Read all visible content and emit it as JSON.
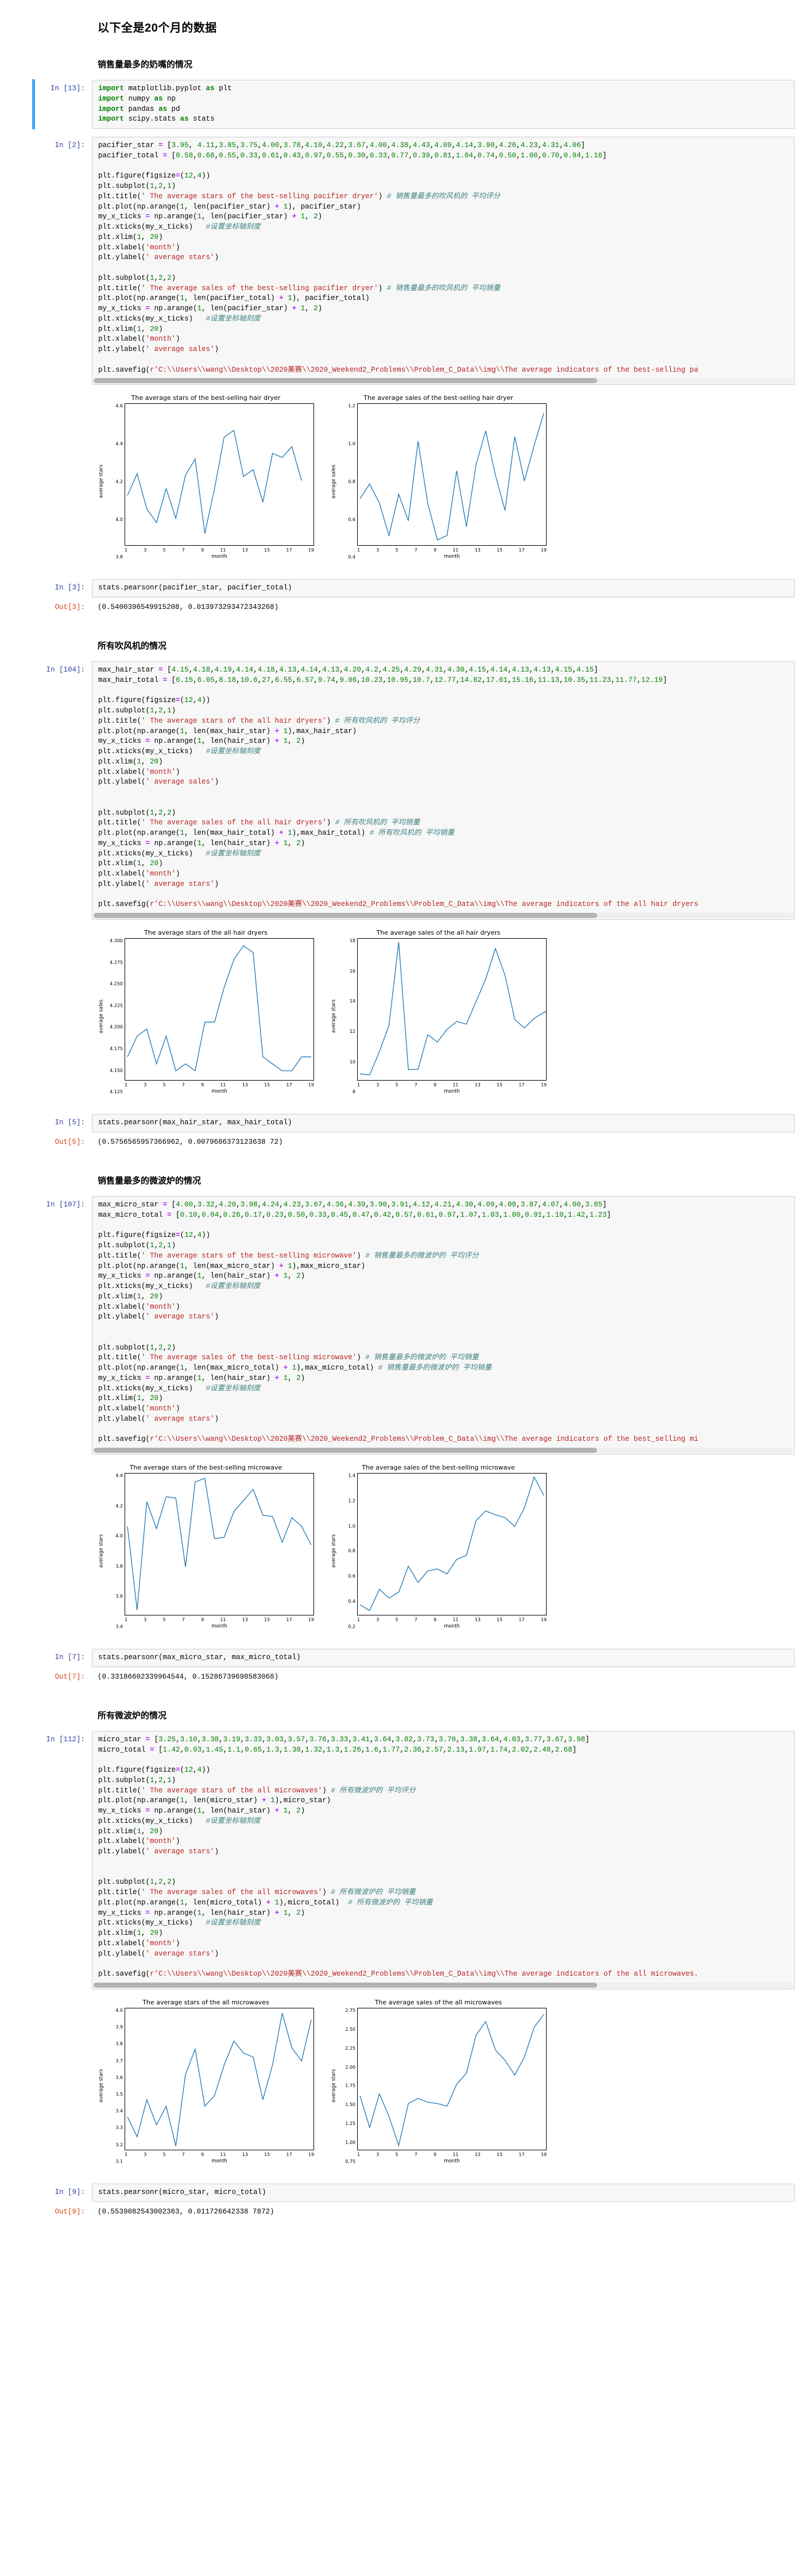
{
  "headings": {
    "main": "以下全是20个月的数据",
    "sec1": "销售量最多的奶嘴的情况",
    "sec2": "所有吹风机的情况",
    "sec3": "销售量最多的微波炉的情况",
    "sec4": "所有微波炉的情况"
  },
  "prompts": {
    "in13": "In [13]:",
    "in2": "In [2]:",
    "in3": "In [3]:",
    "out3": "Out[3]:",
    "in104": "In [104]:",
    "in5": "In [5]:",
    "out5": "Out[5]:",
    "in107": "In [107]:",
    "in7": "In [7]:",
    "out7": "Out[7]:",
    "in112": "In [112]:",
    "in9": "In [9]:",
    "out9": "Out[9]:"
  },
  "cells": {
    "imports": [
      "import matplotlib.pyplot as plt",
      "import numpy as np",
      "import pandas as pd",
      "import scipy.stats as stats"
    ],
    "pacifier_code": [
      "pacifier_star = [3.95, 4.11,3.85,3.75,4.00,3.78,4.10,4.22,3.67,4.00,4.38,4.43,4.09,4.14,3.90,4.26,4.23,4.31,4.06]",
      "pacifier_total = [0.58,0.68,0.55,0.33,0.61,0.43,0.97,0.55,0.30,0.33,0.77,0.39,0.81,1.04,0.74,0.50,1.00,0.70,0.94,1.16]",
      "",
      "plt.figure(figsize=(12,4))",
      "plt.subplot(1,2,1)",
      "plt.title('The average stars of the best-selling pacifier dryer')  # 销售量最多的吹风机的 平均评分",
      "plt.plot(np.arange(1, len(pacifier_star) + 1), pacifier_star)",
      "my_x_ticks = np.arange(1, len(pacifier_star) + 1, 2)",
      "plt.xticks(my_x_ticks)    #设置坐标轴刻度",
      "plt.xlim(1, 20)",
      "plt.xlabel('month')",
      "plt.ylabel('average stars')",
      "",
      "plt.subplot(1,2,2)",
      "plt.title('The average sales of the best-selling pacifier dryer')  # 销售量最多的吹风机的 平均销量",
      "plt.plot(np.arange(1, len(pacifier_total) + 1), pacifier_total)",
      "my_x_ticks = np.arange(1, len(pacifier_star) + 1, 2)",
      "plt.xticks(my_x_ticks)    #设置坐标轴刻度",
      "plt.xlim(1, 20)",
      "plt.xlabel('month')",
      "plt.ylabel('average sales')",
      "",
      "plt.savefig(r'C:\\\\Users\\\\wang\\\\Desktop\\\\2020美赛\\\\2020_Weekend2_Problems\\\\Problem_C_Data\\\\img\\\\The average indicators of the best-selling pa"
    ],
    "pearson_pacifier_code": "stats.pearsonr(pacifier_star, pacifier_total)",
    "pearson_pacifier_out": "(0.5400396549915208, 0.013973293472343268)",
    "hair_code": [
      "max_hair_star = [4.15,4.18,4.19,4.14,4.18,4.13,4.14,4.13,4.20,4.2,4.25,4.29,4.31,4.30,4.15,4.14,4.13,4.13,4.15,4.15]",
      "max_hair_total = [6.15,6.05,8.18,10.6,27,6.55,6.57,9.74,9.06,10.23,10.95,10.7,12.77,14.82,17.61,15.16,11.13,10.35,11.23,11.77,12.19]",
      "",
      "plt.figure(figsize=(12,4))",
      "plt.subplot(1,2,1)",
      "plt.title('The average stars of the all hair dryers')  # 所有吹风机的 平均评分",
      "plt.plot(np.arange(1, len(max_hair_star) + 1), max_hair_star)",
      "my_x_ticks = np.arange(1, len(hair_star) + 1, 2)",
      "plt.xticks(my_x_ticks)    #设置坐标轴刻度",
      "plt.xlim(1, 20)",
      "plt.xlabel('month')",
      "plt.ylabel('average sales')",
      "",
      "",
      "plt.subplot(1,2,2)",
      "plt.title('The average sales of the all hair dryers')  # 所有吹风机的 平均销量",
      "plt.plot(np.arange(1, len(max_hair_total) + 1), max_hair_total)",
      "my_x_ticks = np.arange(1, len(hair_star) + 1, 2)",
      "plt.xticks(my_x_ticks)    #设置坐标轴刻度",
      "plt.xlim(1, 20)",
      "plt.xlabel('month')",
      "plt.ylabel('average stars')",
      "",
      "plt.savefig(r'C:\\\\Users\\\\wang\\\\Desktop\\\\2020美赛\\\\2020_Weekend2_Problems\\\\Problem_C_Data\\\\img\\\\The average indicators of the all hair dryers"
    ],
    "pearson_hair_code": "stats.pearsonr(max_hair_star, max_hair_total)",
    "pearson_hair_out": "(0.5756565957366962, 0.0079686373123638 72)",
    "micro_code": [
      "max_micro_star = [4.00,3.32,4.20,3.98,4.24,4.23,3.67,4.36,4.39,3.90,3.91,4.12,4.21,4.30,4.09,4.08,3.87,4.07,4.00,3.85]",
      "max_micro_total = [0.10,0.04,0.26,0.17,0.23,0.50,0.33,0.45,0.47,0.42,0.57,0.61,0.97,1.07,1.03,1.00,0.91,1.10,1.42,1.23]",
      "",
      "plt.figure(figsize=(12,4))",
      "plt.subplot(1,2,1)",
      "plt.title('The average stars of the best-selling microwave')  # 销售量最多的微波炉的 平均评分",
      "plt.plot(np.arange(1, len(max_micro_star) + 1), max_micro_star)",
      "my_x_ticks = np.arange(1, len(hair_star) + 1, 2)",
      "plt.xticks(my_x_ticks)    #设置坐标轴刻度",
      "plt.xlim(1, 20)",
      "plt.xlabel('month')",
      "plt.ylabel('average stars')",
      "",
      "",
      "plt.subplot(1,2,2)",
      "plt.title('The average sales of the best-selling microwave')  # 销售量最多的微波炉的 平均销量",
      "plt.plot(np.arange(1, len(max_micro_total) + 1),max_micro_total)  # 销售量最多的微波炉的 平均销量",
      "my_x_ticks = np.arange(1, len(hair_star) + 1, 2)",
      "plt.xticks(my_x_ticks)    #设置坐标轴刻度",
      "plt.xlim(1, 20)",
      "plt.xlabel('month')",
      "plt.ylabel('average stars')",
      "",
      "plt.savefig(r'C:\\\\Users\\\\wang\\\\Desktop\\\\2020美赛\\\\2020_Weekend2_Problems\\\\Problem_C_Data\\\\img\\\\The average indicators of the best_selling mi"
    ],
    "pearson_micro_code": "stats.pearsonr(max_micro_star, max_micro_total)",
    "pearson_micro_out": "(0.33186602339964544, 0.15286739698583068)",
    "allmicro_code": [
      "micro_star = [3.25,3.10,3.38,3.19,3.33,3.03,3.57,3.76,3.33,3.41,3.64,3.82,3.73,3.70,3.38,3.64,4.03,3.77,3.67,3.98]",
      "micro_total = [1.42,0.93,1.45,1.1,0.65,1.3,1.38,1.32,1.3,1.26,1.6,1.77,2.36,2.57,2.13,1.97,1.74,2.02,2.48,2.68]",
      "",
      "plt.figure(figsize=(12,4))",
      "plt.subplot(1,2,1)",
      "plt.title('The average stars of the all microwaves')  # 所有微波炉的 平均评分",
      "plt.plot(np.arange(1, len(micro_star) + 1),micro_star)",
      "my_x_ticks = np.arange(1, len(hair_star) + 1, 2)",
      "plt.xticks(my_x_ticks)    #设置坐标轴刻度",
      "plt.xlim(1, 20)",
      "plt.xlabel('month')",
      "plt.ylabel('average stars')",
      "",
      "",
      "plt.subplot(1,2,2)",
      "plt.title('The average sales of the all microwaves')  # 所有微波炉的 平均销量",
      "plt.plot(np.arange(1, len(micro_total) + 1),micro_total)   # 所有微波炉的 平均销量",
      "my_x_ticks = np.arange(1, len(hair_star) + 1, 2)",
      "plt.xticks(my_x_ticks)    #设置坐标轴刻度",
      "plt.xlim(1, 20)",
      "plt.xlabel('month')",
      "plt.ylabel('average stars')",
      "",
      "plt.savefig(r'C:\\\\Users\\\\wang\\\\Desktop\\\\2020美赛\\\\2020_Weekend2_Problems\\\\Problem_C_Data\\\\img\\\\The average indicators of the all microwaves."
    ],
    "pearson_allmicro_code": "stats.pearsonr(micro_star, micro_total)",
    "pearson_allmicro_out": "(0.5539082543002363, 0.011726642338 7872)"
  },
  "chart_data": [
    {
      "type": "line",
      "title": "The average stars of the best-selling hair dryer",
      "xlabel": "month",
      "ylabel": "average stars",
      "x": [
        1,
        2,
        3,
        4,
        5,
        6,
        7,
        8,
        9,
        10,
        11,
        12,
        13,
        14,
        15,
        16,
        17,
        18,
        19
      ],
      "values": [
        3.95,
        4.11,
        3.85,
        3.75,
        4.0,
        3.78,
        4.1,
        4.22,
        3.67,
        4.0,
        4.38,
        4.43,
        4.09,
        4.14,
        3.9,
        4.26,
        4.23,
        4.31,
        4.06
      ],
      "xticks": [
        1,
        3,
        5,
        7,
        9,
        11,
        13,
        15,
        17,
        19
      ],
      "yticks": [
        "3.8",
        "4.0",
        "4.2",
        "4.4",
        "4.6"
      ],
      "xlim": [
        1,
        20
      ],
      "ylim": [
        3.6,
        4.6
      ],
      "grid": false,
      "color": "#1f77b4"
    },
    {
      "type": "line",
      "title": "The average sales of the best-selling hair dryer",
      "xlabel": "month",
      "ylabel": "average sales",
      "x": [
        1,
        2,
        3,
        4,
        5,
        6,
        7,
        8,
        9,
        10,
        11,
        12,
        13,
        14,
        15,
        16,
        17,
        18,
        19,
        20
      ],
      "values": [
        0.58,
        0.68,
        0.55,
        0.33,
        0.61,
        0.43,
        0.97,
        0.55,
        0.3,
        0.33,
        0.77,
        0.39,
        0.81,
        1.04,
        0.74,
        0.5,
        1.0,
        0.7,
        0.94,
        1.16
      ],
      "xticks": [
        1,
        3,
        5,
        7,
        9,
        11,
        13,
        15,
        17,
        19
      ],
      "yticks": [
        "0.4",
        "0.6",
        "0.8",
        "1.0",
        "1.2"
      ],
      "xlim": [
        1,
        20
      ],
      "ylim": [
        0.28,
        1.2
      ],
      "grid": false,
      "color": "#1f77b4"
    },
    {
      "type": "line",
      "title": "The average stars of the all hair dryers",
      "xlabel": "month",
      "ylabel": "average sales",
      "x": [
        1,
        2,
        3,
        4,
        5,
        6,
        7,
        8,
        9,
        10,
        11,
        12,
        13,
        14,
        15,
        16,
        17,
        18,
        19,
        20
      ],
      "values": [
        4.15,
        4.18,
        4.19,
        4.14,
        4.18,
        4.13,
        4.14,
        4.13,
        4.2,
        4.2,
        4.25,
        4.29,
        4.31,
        4.3,
        4.15,
        4.14,
        4.13,
        4.13,
        4.15,
        4.15
      ],
      "xticks": [
        1,
        3,
        5,
        7,
        9,
        11,
        13,
        15,
        17,
        19
      ],
      "yticks": [
        "4.125",
        "4.150",
        "4.175",
        "4.200",
        "4.225",
        "4.250",
        "4.275",
        "4.300"
      ],
      "xlim": [
        1,
        20
      ],
      "ylim": [
        4.12,
        4.315
      ],
      "grid": false,
      "color": "#1f77b4"
    },
    {
      "type": "line",
      "title": "The average sales of the all hair dryers",
      "xlabel": "month",
      "ylabel": "average stars",
      "x": [
        1,
        2,
        3,
        4,
        5,
        6,
        7,
        8,
        9,
        10,
        11,
        12,
        13,
        14,
        15,
        16,
        17,
        18,
        19,
        20,
        21
      ],
      "values": [
        6.15,
        6.05,
        8.18,
        10.6,
        27,
        6.55,
        6.57,
        9.74,
        9.06,
        10.23,
        10.95,
        10.7,
        12.77,
        14.82,
        17.61,
        15.16,
        11.13,
        10.35,
        11.23,
        11.77,
        12.19
      ],
      "xticks": [
        1,
        3,
        5,
        7,
        9,
        11,
        13,
        15,
        17,
        19
      ],
      "yticks": [
        "8",
        "10",
        "12",
        "14",
        "16",
        "18"
      ],
      "xlim": [
        1,
        20
      ],
      "ylim": [
        5.8,
        18.2
      ],
      "grid": false,
      "color": "#1f77b4"
    },
    {
      "type": "line",
      "title": "The average stars of the best-selling microwave",
      "xlabel": "month",
      "ylabel": "average stars",
      "x": [
        1,
        2,
        3,
        4,
        5,
        6,
        7,
        8,
        9,
        10,
        11,
        12,
        13,
        14,
        15,
        16,
        17,
        18,
        19,
        20
      ],
      "values": [
        4.0,
        3.32,
        4.2,
        3.98,
        4.24,
        4.23,
        3.67,
        4.36,
        4.39,
        3.9,
        3.91,
        4.12,
        4.21,
        4.3,
        4.09,
        4.08,
        3.87,
        4.07,
        4.0,
        3.85
      ],
      "xticks": [
        1,
        3,
        5,
        7,
        9,
        11,
        13,
        15,
        17,
        19
      ],
      "yticks": [
        "3.4",
        "3.6",
        "3.8",
        "4.0",
        "4.2",
        "4.4"
      ],
      "xlim": [
        1,
        20
      ],
      "ylim": [
        3.3,
        4.4
      ],
      "grid": false,
      "color": "#1f77b4"
    },
    {
      "type": "line",
      "title": "The average sales of the best-selling microwave",
      "xlabel": "month",
      "ylabel": "average stars",
      "x": [
        1,
        2,
        3,
        4,
        5,
        6,
        7,
        8,
        9,
        10,
        11,
        12,
        13,
        14,
        15,
        16,
        17,
        18,
        19,
        20
      ],
      "values": [
        0.1,
        0.04,
        0.26,
        0.17,
        0.23,
        0.5,
        0.33,
        0.45,
        0.47,
        0.42,
        0.57,
        0.61,
        0.97,
        1.07,
        1.03,
        1.0,
        0.91,
        1.1,
        1.42,
        1.23
      ],
      "xticks": [
        1,
        3,
        5,
        7,
        9,
        11,
        13,
        15,
        17,
        19
      ],
      "yticks": [
        "0.2",
        "0.4",
        "0.6",
        "0.8",
        "1.0",
        "1.2",
        "1.4"
      ],
      "xlim": [
        1,
        20
      ],
      "ylim": [
        0.02,
        1.42
      ],
      "grid": false,
      "color": "#1f77b4"
    },
    {
      "type": "line",
      "title": "The average stars of the all microwaves",
      "xlabel": "month",
      "ylabel": "average stars",
      "x": [
        1,
        2,
        3,
        4,
        5,
        6,
        7,
        8,
        9,
        10,
        11,
        12,
        13,
        14,
        15,
        16,
        17,
        18,
        19,
        20
      ],
      "values": [
        3.25,
        3.1,
        3.38,
        3.19,
        3.33,
        3.03,
        3.57,
        3.76,
        3.33,
        3.41,
        3.64,
        3.82,
        3.73,
        3.7,
        3.38,
        3.64,
        4.03,
        3.77,
        3.67,
        3.98
      ],
      "xticks": [
        1,
        3,
        5,
        7,
        9,
        11,
        13,
        15,
        17,
        19
      ],
      "yticks": [
        "3.1",
        "3.2",
        "3.3",
        "3.4",
        "3.5",
        "3.6",
        "3.7",
        "3.8",
        "3.9",
        "4.0"
      ],
      "xlim": [
        1,
        20
      ],
      "ylim": [
        3.02,
        4.04
      ],
      "grid": false,
      "color": "#1f77b4"
    },
    {
      "type": "line",
      "title": "The average sales of the all microwaves",
      "xlabel": "month",
      "ylabel": "average stars",
      "x": [
        1,
        2,
        3,
        4,
        5,
        6,
        7,
        8,
        9,
        10,
        11,
        12,
        13,
        14,
        15,
        16,
        17,
        18,
        19,
        20
      ],
      "values": [
        1.42,
        0.93,
        1.45,
        1.1,
        0.65,
        1.3,
        1.38,
        1.32,
        1.3,
        1.26,
        1.6,
        1.77,
        2.36,
        2.57,
        2.13,
        1.97,
        1.74,
        2.02,
        2.48,
        2.68
      ],
      "xticks": [
        1,
        3,
        5,
        7,
        9,
        11,
        13,
        15,
        17,
        19
      ],
      "yticks": [
        "0.75",
        "1.00",
        "1.25",
        "1.50",
        "1.75",
        "2.00",
        "2.25",
        "2.50",
        "2.75"
      ],
      "xlim": [
        1,
        20
      ],
      "ylim": [
        0.62,
        2.72
      ],
      "grid": false,
      "color": "#1f77b4"
    }
  ]
}
